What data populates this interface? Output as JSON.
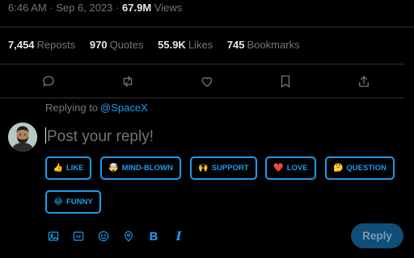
{
  "post_meta": {
    "time": "6:46 AM",
    "separator1": "·",
    "date": "Sep 6, 2023",
    "separator2": "·",
    "views_count": "67.9M",
    "views_label": "Views"
  },
  "stats": [
    {
      "count": "7,454",
      "label": "Reposts"
    },
    {
      "count": "970",
      "label": "Quotes"
    },
    {
      "count": "55.9K",
      "label": "Likes"
    },
    {
      "count": "745",
      "label": "Bookmarks"
    }
  ],
  "actions": [
    "reply-icon",
    "repost-icon",
    "like-icon",
    "bookmark-icon",
    "share-icon"
  ],
  "reply_context": {
    "prefix": "Replying to",
    "handle": "@SpaceX"
  },
  "composer": {
    "placeholder": "Post your reply!"
  },
  "reactions": [
    {
      "emoji": "👍",
      "label": "LIKE"
    },
    {
      "emoji": "🤯",
      "label": "MIND-BLOWN"
    },
    {
      "emoji": "🙌",
      "label": "SUPPORT"
    },
    {
      "emoji": "❤️",
      "label": "LOVE"
    },
    {
      "emoji": "🤔",
      "label": "QUESTION"
    },
    {
      "emoji": "😂",
      "label": "FUNNY"
    }
  ],
  "toolbar": {
    "icons": [
      "image-icon",
      "gif-icon",
      "emoji-icon",
      "location-icon",
      "bold-icon",
      "italic-icon"
    ],
    "bold_glyph": "B",
    "italic_glyph": "I",
    "gif_glyph": "GIF",
    "reply_label": "Reply"
  },
  "colors": {
    "background": "#000000",
    "accent": "#1d9bf0",
    "muted": "#71767b",
    "text": "#e7e9ea",
    "divider": "#2f3336",
    "reply_button_disabled": "#0f4e78"
  }
}
